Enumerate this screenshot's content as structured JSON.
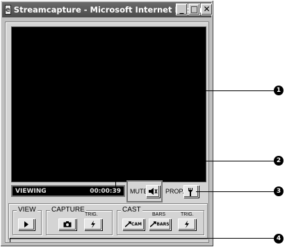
{
  "window": {
    "title": "Streamcapture - Microsoft Internet Explorer",
    "minimize": "_",
    "maximize": "□",
    "close": "✕"
  },
  "status": {
    "mode": "VIEWING",
    "time": "00:00:39"
  },
  "controls": {
    "mute_label": "MUTE",
    "prop_label": "PROP."
  },
  "groups": {
    "view": {
      "label": "VIEW"
    },
    "capture": {
      "label": "CAPTURE",
      "trig_label": "TRIG."
    },
    "cast": {
      "label": "CAST",
      "cam_label": "CAM",
      "bars_top_label": "BARS",
      "bars_label": "BARS",
      "trig_label": "TRIG."
    }
  },
  "callouts": [
    "1",
    "2",
    "3",
    "4"
  ]
}
